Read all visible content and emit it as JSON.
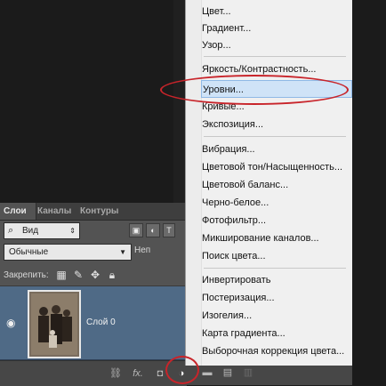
{
  "menu": {
    "items": [
      {
        "label": "Цвет..."
      },
      {
        "label": "Градиент..."
      },
      {
        "label": "Узор..."
      },
      {
        "label": "Яркость/Контрастность..."
      },
      {
        "label": "Уровни..."
      },
      {
        "label": "Кривые..."
      },
      {
        "label": "Экспозиция..."
      },
      {
        "label": "Вибрация..."
      },
      {
        "label": "Цветовой тон/Насыщенность..."
      },
      {
        "label": "Цветовой баланс..."
      },
      {
        "label": "Черно-белое..."
      },
      {
        "label": "Фотофильтр..."
      },
      {
        "label": "Микширование каналов..."
      },
      {
        "label": "Поиск цвета..."
      },
      {
        "label": "Инвертировать"
      },
      {
        "label": "Постеризация..."
      },
      {
        "label": "Изогелия..."
      },
      {
        "label": "Карта градиента..."
      },
      {
        "label": "Выборочная коррекция цвета..."
      }
    ],
    "selected": "Уровни..."
  },
  "layers_panel": {
    "tabs": [
      "Слои",
      "Каналы",
      "Контуры"
    ],
    "filter": {
      "value": "Вид",
      "icons": [
        "image-filter-icon",
        "adjustment-filter-icon",
        "type-filter-icon"
      ]
    },
    "blend_mode": "Обычные",
    "opacity_label": "Неп",
    "lock_label": "Закрепить:",
    "layer": {
      "name": "Слой 0"
    },
    "bottom_icons": [
      "link-icon",
      "fx-icon",
      "mask-icon",
      "adjustment-layer-icon",
      "folder-icon",
      "new-layer-icon",
      "trash-icon"
    ],
    "fx_label": "fx."
  },
  "colors": {
    "highlight": "#c8242a",
    "layer_selected": "#4f6a86",
    "menu_bg": "#f0f0f0"
  }
}
